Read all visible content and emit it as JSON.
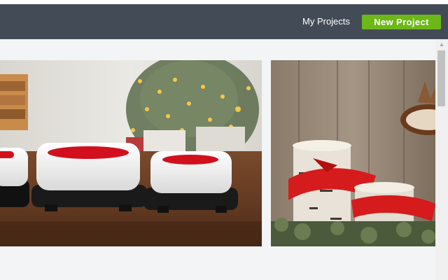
{
  "header": {
    "my_projects_label": "My Projects",
    "new_project_label": "New Project",
    "background_color": "#434c56",
    "accent_color": "#6bb817"
  },
  "gallery": {
    "cards": [
      {
        "subject": "heat presses in front of decorated christmas tree"
      },
      {
        "subject": "birch log candle holders with red ribbons and reindeer decor"
      }
    ]
  },
  "scrollbar": {
    "arrow_icon": "triangle-up",
    "position": 0.0
  }
}
